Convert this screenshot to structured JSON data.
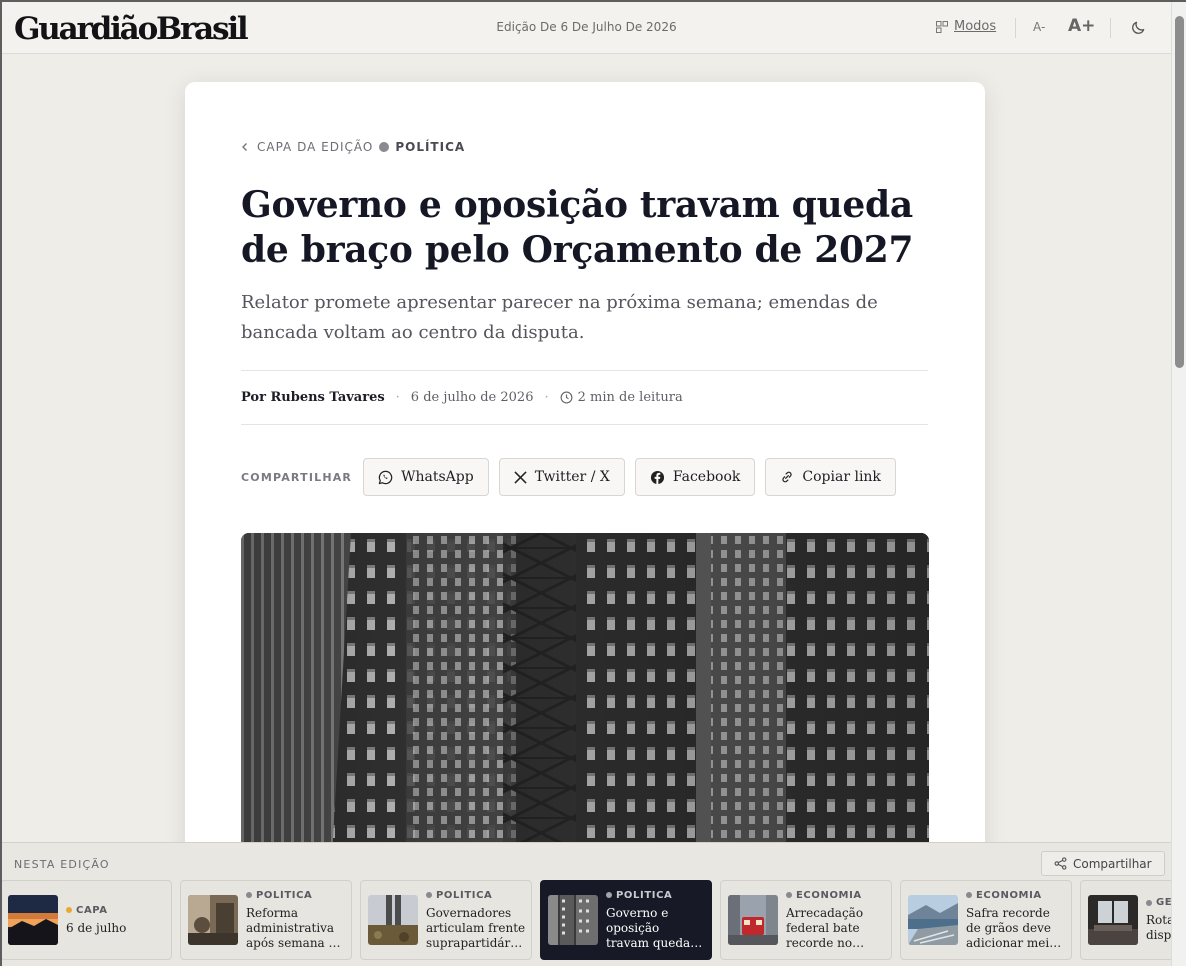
{
  "header": {
    "logo": "GuardiãoBrasil",
    "edition": "Edição De 6 De Julho De 2026",
    "modes_label": "Modos",
    "font_smaller": "A-",
    "font_larger": "A+"
  },
  "article": {
    "breadcrumb_back": "CAPA DA EDIÇÃO",
    "category": "POLÍTICA",
    "title": "Governo e oposição travam queda de braço pelo Orçamento de 2027",
    "subtitle": "Relator promete apresentar parecer na próxima semana; emendas de bancada voltam ao centro da disputa.",
    "author": "Por Rubens Tavares",
    "date": "6 de julho de 2026",
    "read_time": "2 min de leitura",
    "share_label": "COMPARTILHAR",
    "share_buttons": {
      "whatsapp": "WhatsApp",
      "twitter": "Twitter / X",
      "facebook": "Facebook",
      "copy": "Copiar link"
    }
  },
  "edition_bar": {
    "label": "NESTA EDIÇÃO",
    "share_label": "Compartilhar",
    "items": [
      {
        "category": "CAPA",
        "title": "6 de julho",
        "active": false
      },
      {
        "category": "POLÍTICA",
        "title": "Reforma administrativa após semana de negociações",
        "active": false
      },
      {
        "category": "POLÍTICA",
        "title": "Governadores articulam frente suprapartidária pela segurança",
        "active": false
      },
      {
        "category": "POLÍTICA",
        "title": "Governo e oposição travam queda de braço pelo Orçamento",
        "active": true
      },
      {
        "category": "ECONOMIA",
        "title": "Arrecadação federal bate recorde no semestre",
        "active": false
      },
      {
        "category": "ECONOMIA",
        "title": "Safra recorde de grãos deve adicionar meio ponto ao PIB",
        "active": false
      },
      {
        "category": "GEO",
        "title": "Rota Ártica disputa",
        "active": false
      }
    ]
  },
  "colors": {
    "accent_dark": "#171926",
    "background": "#efede8",
    "capa_dot": "#e8a92e"
  }
}
